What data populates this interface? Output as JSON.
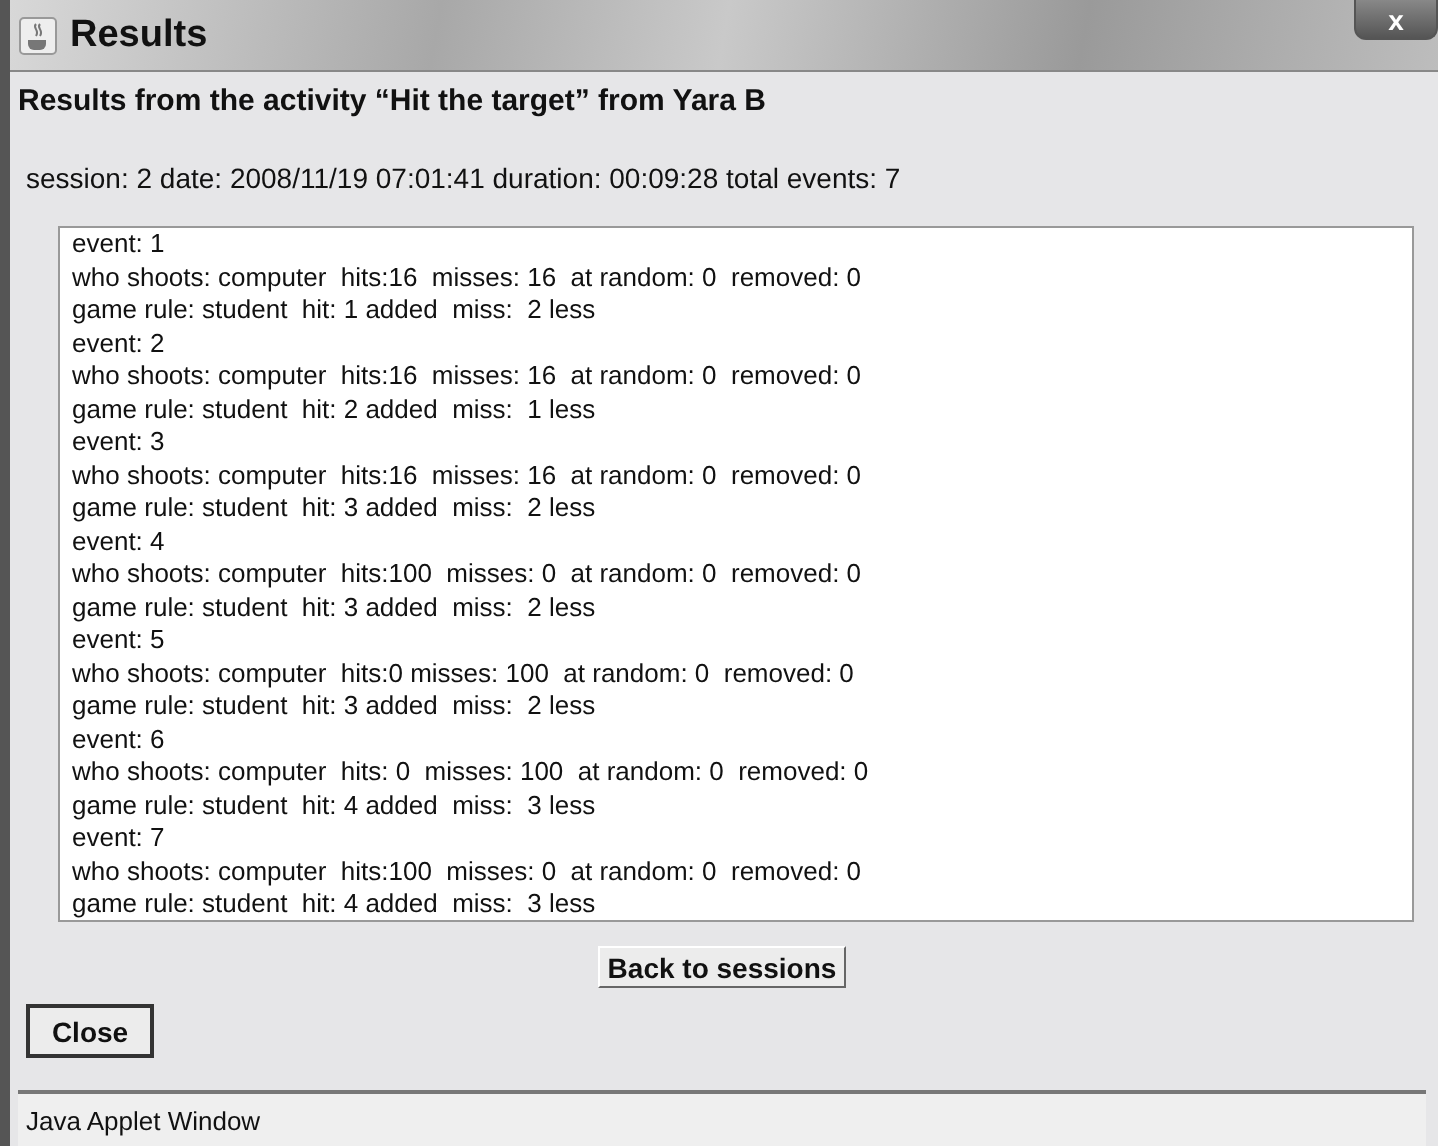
{
  "window": {
    "title": "Results",
    "close_label": "x"
  },
  "heading": "Results from the activity “Hit the target” from Yara B",
  "session_line": "session: 2  date: 2008/11/19  07:01:41  duration: 00:09:28  total events: 7",
  "log_lines": [
    "event: 1",
    "who shoots: computer  hits:16  misses: 16  at random: 0  removed: 0",
    "game rule: student  hit: 1 added  miss:  2 less",
    "event: 2",
    "who shoots: computer  hits:16  misses: 16  at random: 0  removed: 0",
    "game rule: student  hit: 2 added  miss:  1 less",
    "event: 3",
    "who shoots: computer  hits:16  misses: 16  at random: 0  removed: 0",
    "game rule: student  hit: 3 added  miss:  2 less",
    "event: 4",
    "who shoots: computer  hits:100  misses: 0  at random: 0  removed: 0",
    "game rule: student  hit: 3 added  miss:  2 less",
    "event: 5",
    "who shoots: computer  hits:0 misses: 100  at random: 0  removed: 0",
    "game rule: student  hit: 3 added  miss:  2 less",
    "event: 6",
    "who shoots: computer  hits: 0  misses: 100  at random: 0  removed: 0",
    "game rule: student  hit: 4 added  miss:  3 less",
    "event: 7",
    "who shoots: computer  hits:100  misses: 0  at random: 0  removed: 0",
    "game rule: student  hit: 4 added  miss:  3 less"
  ],
  "back_button": "Back to sessions",
  "close_button": "Close",
  "status_bar": "Java Applet Window"
}
